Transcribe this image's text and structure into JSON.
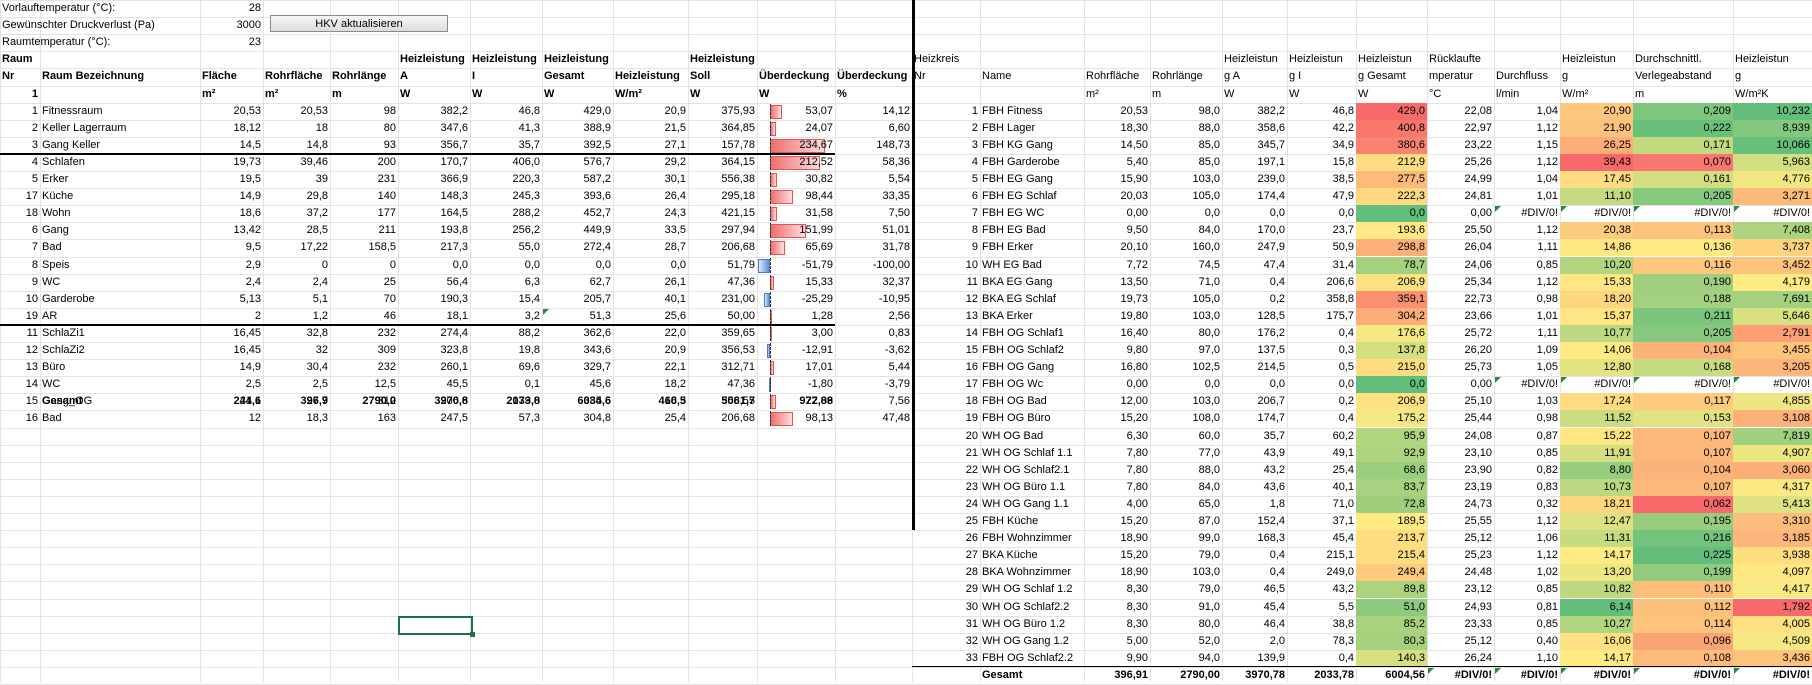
{
  "params": [
    {
      "label": "Vorlauftemperatur (°C):",
      "value": "28"
    },
    {
      "label": "Gewünschter Druckverlust (Pa)",
      "value": "3000"
    },
    {
      "label": "Raumtemperatur (°C):",
      "value": "23"
    }
  ],
  "button_label": "HKV aktualisieren",
  "left_header": {
    "raum": "Raum",
    "nr": "Nr",
    "bez": "Raum Bezeichnung",
    "cols": [
      {
        "h1": "",
        "h2": "Fläche",
        "u": "m²"
      },
      {
        "h1": "",
        "h2": "Rohrfläche",
        "u": "m²"
      },
      {
        "h1": "",
        "h2": "Rohrlänge",
        "u": "m"
      },
      {
        "h1": "Heizleistung",
        "h2": "A",
        "u": "W"
      },
      {
        "h1": "Heizleistung",
        "h2": "I",
        "u": "W"
      },
      {
        "h1": "Heizleistung",
        "h2": "Gesamt",
        "u": "W"
      },
      {
        "h1": "",
        "h2": "Heizleistung",
        "u": "W/m²"
      },
      {
        "h1": "Heizleistung",
        "h2": "Soll",
        "u": "W"
      },
      {
        "h1": "",
        "h2": "Überdeckung",
        "u": "W"
      },
      {
        "h1": "",
        "h2": "Überdeckung",
        "u": "%"
      }
    ],
    "unit_nr": "1"
  },
  "left_rows": [
    {
      "nr": "1",
      "name": "Fitnessraum",
      "v": [
        "20,53",
        "20,53",
        "98",
        "382,2",
        "46,8",
        "429,0",
        "20,9",
        "375,93",
        "53,07",
        "14,12"
      ],
      "ub": 53.07
    },
    {
      "nr": "2",
      "name": "Keller Lagerraum",
      "v": [
        "18,12",
        "18",
        "80",
        "347,6",
        "41,3",
        "388,9",
        "21,5",
        "364,85",
        "24,07",
        "6,60"
      ],
      "ub": 24.07
    },
    {
      "nr": "3",
      "name": "Gang Keller",
      "v": [
        "14,5",
        "14,8",
        "93",
        "356,7",
        "35,7",
        "392,5",
        "27,1",
        "157,78",
        "234,67",
        "148,73"
      ],
      "ub": 234.67
    },
    {
      "nr": "4",
      "name": "Schlafen",
      "v": [
        "19,73",
        "39,46",
        "200",
        "170,7",
        "406,0",
        "576,7",
        "29,2",
        "364,15",
        "212,52",
        "58,36"
      ],
      "ub": 212.52
    },
    {
      "nr": "5",
      "name": "Erker",
      "v": [
        "19,5",
        "39",
        "231",
        "366,9",
        "220,3",
        "587,2",
        "30,1",
        "556,38",
        "30,82",
        "5,54"
      ],
      "ub": 30.82
    },
    {
      "nr": "17",
      "name": "Küche",
      "v": [
        "14,9",
        "29,8",
        "140",
        "148,3",
        "245,3",
        "393,6",
        "26,4",
        "295,18",
        "98,44",
        "33,35"
      ],
      "ub": 98.44
    },
    {
      "nr": "18",
      "name": "Wohn",
      "v": [
        "18,6",
        "37,2",
        "177",
        "164,5",
        "288,2",
        "452,7",
        "24,3",
        "421,15",
        "31,58",
        "7,50"
      ],
      "ub": 31.58
    },
    {
      "nr": "6",
      "name": "Gang",
      "v": [
        "13,42",
        "28,5",
        "211",
        "193,8",
        "256,2",
        "449,9",
        "33,5",
        "297,94",
        "151,99",
        "51,01"
      ],
      "ub": 151.99
    },
    {
      "nr": "7",
      "name": "Bad",
      "v": [
        "9,5",
        "17,22",
        "158,5",
        "217,3",
        "55,0",
        "272,4",
        "28,7",
        "206,68",
        "65,69",
        "31,78"
      ],
      "ub": 65.69
    },
    {
      "nr": "8",
      "name": "Speis",
      "v": [
        "2,9",
        "0",
        "0",
        "0,0",
        "0,0",
        "0,0",
        "0,0",
        "51,79",
        "-51,79",
        "-100,00"
      ],
      "ub": -51.79
    },
    {
      "nr": "9",
      "name": "WC",
      "v": [
        "2,4",
        "2,4",
        "25",
        "56,4",
        "6,3",
        "62,7",
        "26,1",
        "47,36",
        "15,33",
        "32,37"
      ],
      "ub": 15.33
    },
    {
      "nr": "10",
      "name": "Garderobe",
      "v": [
        "5,13",
        "5,1",
        "70",
        "190,3",
        "15,4",
        "205,7",
        "40,1",
        "231,00",
        "-25,29",
        "-10,95"
      ],
      "ub": -25.29
    },
    {
      "nr": "19",
      "name": "AR",
      "v": [
        "2",
        "1,2",
        "46",
        "18,1",
        "3,2",
        "51,3",
        "25,6",
        "50,00",
        "1,28",
        "2,56"
      ],
      "ub": 1.28
    },
    {
      "nr": "11",
      "name": "SchlaZi1",
      "v": [
        "16,45",
        "32,8",
        "232",
        "274,4",
        "88,2",
        "362,6",
        "22,0",
        "359,65",
        "3,00",
        "0,83"
      ],
      "ub": 3.0
    },
    {
      "nr": "12",
      "name": "SchlaZi2",
      "v": [
        "16,45",
        "32",
        "309",
        "323,8",
        "19,8",
        "343,6",
        "20,9",
        "356,53",
        "-12,91",
        "-3,62"
      ],
      "ub": -12.91
    },
    {
      "nr": "13",
      "name": "Büro",
      "v": [
        "14,9",
        "30,4",
        "232",
        "260,1",
        "69,6",
        "329,7",
        "22,1",
        "312,71",
        "17,01",
        "5,44"
      ],
      "ub": 17.01
    },
    {
      "nr": "14",
      "name": "WC",
      "v": [
        "2,5",
        "2,5",
        "12,5",
        "45,5",
        "0,1",
        "45,6",
        "18,2",
        "47,36",
        "-1,80",
        "-3,79"
      ],
      "ub": -1.8
    },
    {
      "nr": "15",
      "name": "Gang_OG",
      "v": [
        "21,1",
        "27,7",
        "312",
        "206,6",
        "179,0",
        "385,6",
        "18,3",
        "358,55",
        "27,09",
        "7,56"
      ],
      "ub": 27.09
    },
    {
      "nr": "16",
      "name": "Bad",
      "v": [
        "12",
        "18,3",
        "163",
        "247,5",
        "57,3",
        "304,8",
        "25,4",
        "206,68",
        "98,13",
        "47,48"
      ],
      "ub": 98.13
    }
  ],
  "left_total": {
    "label": "Gesamt",
    "v": [
      "244,6",
      "396,9",
      "2790,0",
      "3970,8",
      "2033,8",
      "6034,6",
      "460,5",
      "5061,7",
      "972,88"
    ]
  },
  "right_header": {
    "h1": [
      "Heizkreis",
      "",
      "",
      "",
      "Heizleistun",
      "Heizleistun",
      "Heizleistun",
      "Rücklaufte",
      "",
      "Heizleistun",
      "Durchschnittl.",
      "Heizleistun"
    ],
    "h2": [
      "Nr",
      "Name",
      "Rohrfläche",
      "Rohrlänge",
      "g A",
      "g I",
      "g Gesamt",
      "mperatur",
      "Durchfluss",
      "g",
      "Verlegeabstand",
      "g"
    ],
    "u": [
      "",
      "",
      "m²",
      "m",
      "W",
      "W",
      "W",
      "°C",
      "l/min",
      "W/m²",
      "m",
      "W/m²K"
    ]
  },
  "right_rows": [
    {
      "nr": "1",
      "name": "FBH Fitness",
      "v": [
        "20,53",
        "98,0",
        "382,2",
        "46,8",
        "429,0",
        "22,08",
        "1,04",
        "20,90",
        "0,209",
        "10,232"
      ],
      "g": 429.0,
      "wm": 20.9,
      "va": 0.209,
      "wk": 10.232
    },
    {
      "nr": "2",
      "name": "FBH Lager",
      "v": [
        "18,30",
        "88,0",
        "358,6",
        "42,2",
        "400,8",
        "22,97",
        "1,12",
        "21,90",
        "0,222",
        "8,939"
      ],
      "g": 400.8,
      "wm": 21.9,
      "va": 0.222,
      "wk": 8.939
    },
    {
      "nr": "3",
      "name": "FBH KG Gang",
      "v": [
        "14,50",
        "85,0",
        "345,7",
        "34,9",
        "380,6",
        "23,22",
        "1,15",
        "26,25",
        "0,171",
        "10,066"
      ],
      "g": 380.6,
      "wm": 26.25,
      "va": 0.171,
      "wk": 10.066
    },
    {
      "nr": "4",
      "name": "FBH Garderobe",
      "v": [
        "5,40",
        "85,0",
        "197,1",
        "15,8",
        "212,9",
        "25,26",
        "1,12",
        "39,43",
        "0,070",
        "5,963"
      ],
      "g": 212.9,
      "wm": 39.43,
      "va": 0.07,
      "wk": 5.963
    },
    {
      "nr": "5",
      "name": "FBH EG Gang",
      "v": [
        "15,90",
        "103,0",
        "239,0",
        "38,5",
        "277,5",
        "24,99",
        "1,04",
        "17,45",
        "0,161",
        "4,776"
      ],
      "g": 277.5,
      "wm": 17.45,
      "va": 0.161,
      "wk": 4.776
    },
    {
      "nr": "6",
      "name": "FBH EG Schlaf",
      "v": [
        "20,03",
        "105,0",
        "174,4",
        "47,9",
        "222,3",
        "24,81",
        "1,01",
        "11,10",
        "0,205",
        "3,271"
      ],
      "g": 222.3,
      "wm": 11.1,
      "va": 0.205,
      "wk": 3.271
    },
    {
      "nr": "7",
      "name": "FBH EG WC",
      "v": [
        "0,00",
        "0,0",
        "0,0",
        "0,0",
        "0,0",
        "0,00",
        "#DIV/0!",
        "#DIV/0!",
        "#DIV/0!",
        "#DIV/0!"
      ],
      "g": 0.0,
      "wm": null,
      "va": null,
      "wk": null
    },
    {
      "nr": "8",
      "name": "FBH EG Bad",
      "v": [
        "9,50",
        "84,0",
        "170,0",
        "23,7",
        "193,6",
        "25,50",
        "1,12",
        "20,38",
        "0,113",
        "7,408"
      ],
      "g": 193.6,
      "wm": 20.38,
      "va": 0.113,
      "wk": 7.408
    },
    {
      "nr": "9",
      "name": "FBH Erker",
      "v": [
        "20,10",
        "160,0",
        "247,9",
        "50,9",
        "298,8",
        "26,04",
        "1,11",
        "14,86",
        "0,136",
        "3,737"
      ],
      "g": 298.8,
      "wm": 14.86,
      "va": 0.136,
      "wk": 3.737
    },
    {
      "nr": "10",
      "name": "WH EG Bad",
      "v": [
        "7,72",
        "74,5",
        "47,4",
        "31,4",
        "78,7",
        "24,06",
        "0,85",
        "10,20",
        "0,116",
        "3,452"
      ],
      "g": 78.7,
      "wm": 10.2,
      "va": 0.116,
      "wk": 3.452
    },
    {
      "nr": "11",
      "name": "BKA EG Gang",
      "v": [
        "13,50",
        "71,0",
        "0,4",
        "206,6",
        "206,9",
        "25,34",
        "1,12",
        "15,33",
        "0,190",
        "4,179"
      ],
      "g": 206.9,
      "wm": 15.33,
      "va": 0.19,
      "wk": 4.179
    },
    {
      "nr": "12",
      "name": "BKA EG Schlaf",
      "v": [
        "19,73",
        "105,0",
        "0,2",
        "358,8",
        "359,1",
        "22,73",
        "0,98",
        "18,20",
        "0,188",
        "7,691"
      ],
      "g": 359.1,
      "wm": 18.2,
      "va": 0.188,
      "wk": 7.691
    },
    {
      "nr": "13",
      "name": "BKA Erker",
      "v": [
        "19,80",
        "103,0",
        "128,5",
        "175,7",
        "304,2",
        "23,66",
        "1,01",
        "15,37",
        "0,211",
        "5,646"
      ],
      "g": 304.2,
      "wm": 15.37,
      "va": 0.211,
      "wk": 5.646
    },
    {
      "nr": "14",
      "name": "FBH OG Schlaf1",
      "v": [
        "16,40",
        "80,0",
        "176,2",
        "0,4",
        "176,6",
        "25,72",
        "1,11",
        "10,77",
        "0,205",
        "2,791"
      ],
      "g": 176.6,
      "wm": 10.77,
      "va": 0.205,
      "wk": 2.791
    },
    {
      "nr": "15",
      "name": "FBH OG Schlaf2",
      "v": [
        "9,80",
        "97,0",
        "137,5",
        "0,3",
        "137,8",
        "26,20",
        "1,09",
        "14,06",
        "0,104",
        "3,455"
      ],
      "g": 137.8,
      "wm": 14.06,
      "va": 0.104,
      "wk": 3.455
    },
    {
      "nr": "16",
      "name": "FBH OG Gang",
      "v": [
        "16,80",
        "102,5",
        "214,5",
        "0,5",
        "215,0",
        "25,73",
        "1,05",
        "12,80",
        "0,168",
        "3,205"
      ],
      "g": 215.0,
      "wm": 12.8,
      "va": 0.168,
      "wk": 3.205
    },
    {
      "nr": "17",
      "name": "FBH OG Wc",
      "v": [
        "0,00",
        "0,0",
        "0,0",
        "0,0",
        "0,0",
        "0,00",
        "#DIV/0!",
        "#DIV/0!",
        "#DIV/0!",
        "#DIV/0!"
      ],
      "g": 0.0,
      "wm": null,
      "va": null,
      "wk": null
    },
    {
      "nr": "18",
      "name": "FBH OG Bad",
      "v": [
        "12,00",
        "103,0",
        "206,7",
        "0,2",
        "206,9",
        "25,10",
        "1,03",
        "17,24",
        "0,117",
        "4,855"
      ],
      "g": 206.9,
      "wm": 17.24,
      "va": 0.117,
      "wk": 4.855
    },
    {
      "nr": "19",
      "name": "FBH OG Büro",
      "v": [
        "15,20",
        "108,0",
        "174,7",
        "0,4",
        "175,2",
        "25,44",
        "0,98",
        "11,52",
        "0,153",
        "3,108"
      ],
      "g": 175.2,
      "wm": 11.52,
      "va": 0.153,
      "wk": 3.108
    },
    {
      "nr": "20",
      "name": "WH OG Bad",
      "v": [
        "6,30",
        "60,0",
        "35,7",
        "60,2",
        "95,9",
        "24,08",
        "0,87",
        "15,22",
        "0,107",
        "7,819"
      ],
      "g": 95.9,
      "wm": 15.22,
      "va": 0.107,
      "wk": 7.819
    },
    {
      "nr": "21",
      "name": "WH OG Schlaf 1.1",
      "v": [
        "7,80",
        "77,0",
        "43,9",
        "49,1",
        "92,9",
        "23,10",
        "0,85",
        "11,91",
        "0,107",
        "4,907"
      ],
      "g": 92.9,
      "wm": 11.91,
      "va": 0.107,
      "wk": 4.907
    },
    {
      "nr": "22",
      "name": "WH OG Schlaf2.1",
      "v": [
        "7,80",
        "88,0",
        "43,2",
        "25,4",
        "68,6",
        "23,90",
        "0,82",
        "8,80",
        "0,104",
        "3,060"
      ],
      "g": 68.6,
      "wm": 8.8,
      "va": 0.104,
      "wk": 3.06
    },
    {
      "nr": "23",
      "name": "WH OG Büro 1.1",
      "v": [
        "7,80",
        "84,0",
        "43,6",
        "40,1",
        "83,7",
        "23,19",
        "0,83",
        "10,73",
        "0,107",
        "4,317"
      ],
      "g": 83.7,
      "wm": 10.73,
      "va": 0.107,
      "wk": 4.317
    },
    {
      "nr": "24",
      "name": "WH OG Gang 1.1",
      "v": [
        "4,00",
        "65,0",
        "1,8",
        "71,0",
        "72,8",
        "24,73",
        "0,32",
        "18,21",
        "0,062",
        "5,413"
      ],
      "g": 72.8,
      "wm": 18.21,
      "va": 0.062,
      "wk": 5.413
    },
    {
      "nr": "25",
      "name": "FBH Küche",
      "v": [
        "15,20",
        "87,0",
        "152,4",
        "37,1",
        "189,5",
        "25,55",
        "1,12",
        "12,47",
        "0,195",
        "3,310"
      ],
      "g": 189.5,
      "wm": 12.47,
      "va": 0.195,
      "wk": 3.31
    },
    {
      "nr": "26",
      "name": "FBH Wohnzimmer",
      "v": [
        "18,90",
        "99,0",
        "168,3",
        "45,4",
        "213,7",
        "25,12",
        "1,06",
        "11,31",
        "0,216",
        "3,185"
      ],
      "g": 213.7,
      "wm": 11.31,
      "va": 0.216,
      "wk": 3.185
    },
    {
      "nr": "27",
      "name": "BKA Küche",
      "v": [
        "15,20",
        "79,0",
        "0,4",
        "215,1",
        "215,4",
        "25,23",
        "1,12",
        "14,17",
        "0,225",
        "3,938"
      ],
      "g": 215.4,
      "wm": 14.17,
      "va": 0.225,
      "wk": 3.938
    },
    {
      "nr": "28",
      "name": "BKA Wohnzimmer",
      "v": [
        "18,90",
        "103,0",
        "0,4",
        "249,0",
        "249,4",
        "24,48",
        "1,02",
        "13,20",
        "0,199",
        "4,097"
      ],
      "g": 249.4,
      "wm": 13.2,
      "va": 0.199,
      "wk": 4.097
    },
    {
      "nr": "29",
      "name": "WH OG Schlaf 1.2",
      "v": [
        "8,30",
        "79,0",
        "46,5",
        "43,2",
        "89,8",
        "23,12",
        "0,85",
        "10,82",
        "0,110",
        "4,417"
      ],
      "g": 89.8,
      "wm": 10.82,
      "va": 0.11,
      "wk": 4.417
    },
    {
      "nr": "30",
      "name": "WH OG Schlaf2.2",
      "v": [
        "8,30",
        "91,0",
        "45,4",
        "5,5",
        "51,0",
        "24,93",
        "0,81",
        "6,14",
        "0,112",
        "1,792"
      ],
      "g": 51.0,
      "wm": 6.14,
      "va": 0.112,
      "wk": 1.792
    },
    {
      "nr": "31",
      "name": "WH OG Büro 1.2",
      "v": [
        "8,30",
        "80,0",
        "46,4",
        "38,8",
        "85,2",
        "23,33",
        "0,85",
        "10,27",
        "0,114",
        "4,005"
      ],
      "g": 85.2,
      "wm": 10.27,
      "va": 0.114,
      "wk": 4.005
    },
    {
      "nr": "32",
      "name": "WH OG Gang 1.2",
      "v": [
        "5,00",
        "52,0",
        "2,0",
        "78,3",
        "80,3",
        "25,12",
        "0,40",
        "16,06",
        "0,096",
        "4,509"
      ],
      "g": 80.3,
      "wm": 16.06,
      "va": 0.096,
      "wk": 4.509
    },
    {
      "nr": "33",
      "name": "FBH OG Schlaf2.2",
      "v": [
        "9,90",
        "94,0",
        "139,9",
        "0,4",
        "140,3",
        "26,24",
        "1,10",
        "14,17",
        "0,108",
        "3,436"
      ],
      "g": 140.3,
      "wm": 14.17,
      "va": 0.108,
      "wk": 3.436
    }
  ],
  "right_total": {
    "label": "Gesamt",
    "v": [
      "396,91",
      "2790,00",
      "3970,78",
      "2033,78",
      "6004,56",
      "#DIV/0!",
      "#DIV/0!",
      "#DIV/0!",
      "#DIV/0!",
      "#DIV/0!"
    ]
  }
}
